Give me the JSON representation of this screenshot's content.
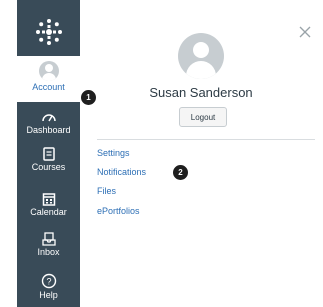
{
  "nav": {
    "items": [
      {
        "label": "Account",
        "icon": "account-avatar-icon"
      },
      {
        "label": "Dashboard",
        "icon": "dashboard-icon"
      },
      {
        "label": "Courses",
        "icon": "courses-icon"
      },
      {
        "label": "Calendar",
        "icon": "calendar-icon"
      },
      {
        "label": "Inbox",
        "icon": "inbox-icon"
      },
      {
        "label": "Help",
        "icon": "help-icon"
      }
    ]
  },
  "panel": {
    "user_name": "Susan Sanderson",
    "logout_label": "Logout",
    "links": [
      "Settings",
      "Notifications",
      "Files",
      "ePortfolios"
    ]
  },
  "callouts": [
    "1",
    "2"
  ],
  "colors": {
    "nav_bg": "#394b58",
    "link": "#2d6fb5",
    "text": "#2d3b45"
  }
}
